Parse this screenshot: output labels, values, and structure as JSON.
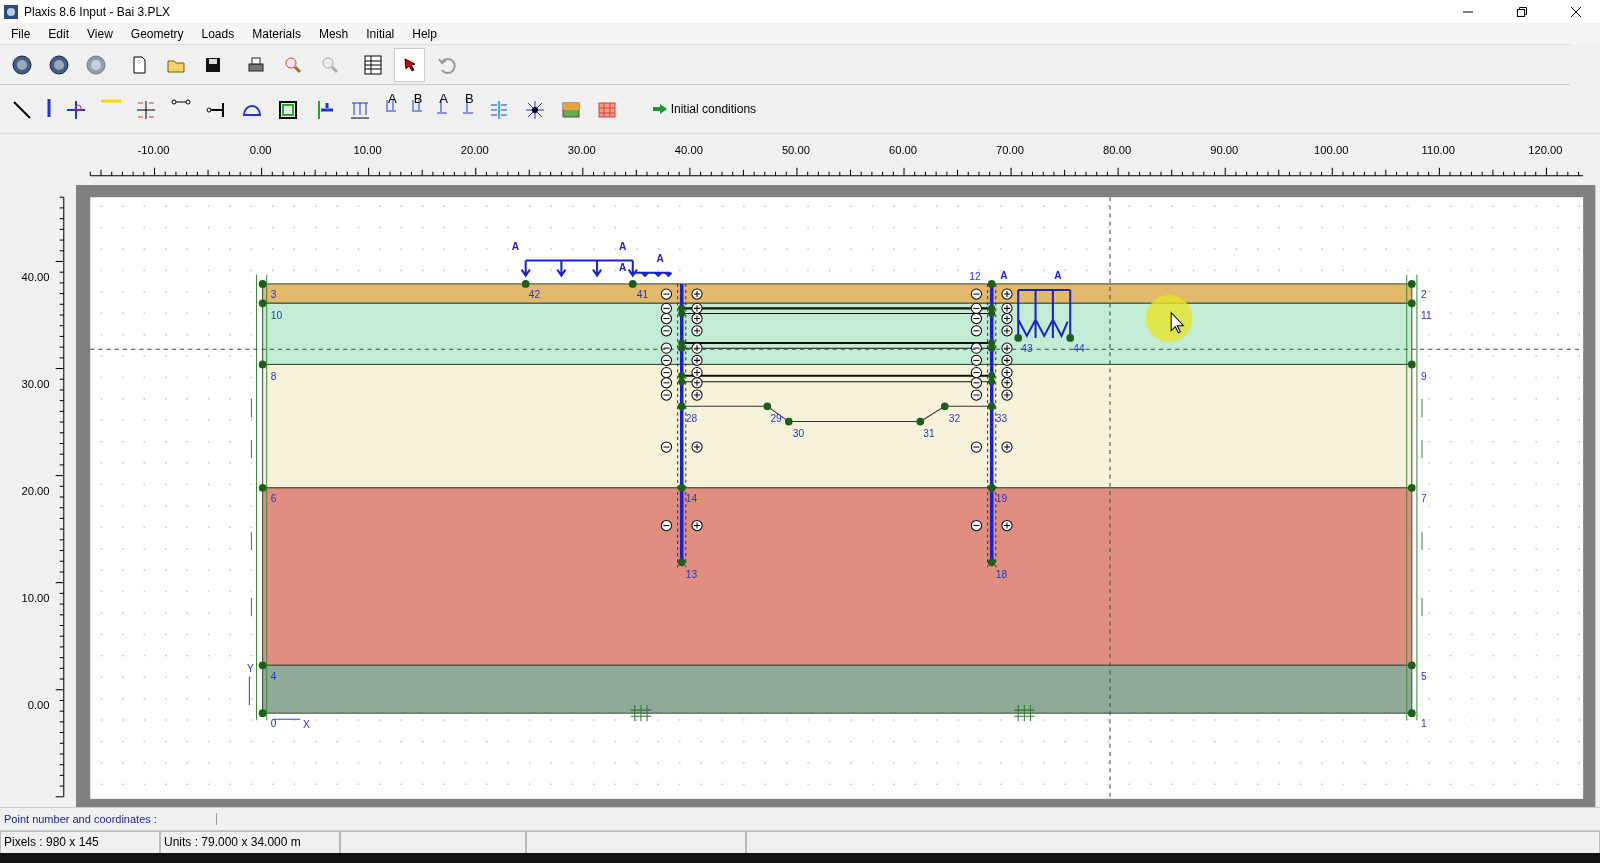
{
  "window": {
    "title": "Plaxis 8.6 Input - Bai 3.PLX"
  },
  "menu": [
    {
      "label": "File"
    },
    {
      "label": "Edit"
    },
    {
      "label": "View"
    },
    {
      "label": "Geometry"
    },
    {
      "label": "Loads"
    },
    {
      "label": "Materials"
    },
    {
      "label": "Mesh"
    },
    {
      "label": "Initial"
    },
    {
      "label": "Help"
    }
  ],
  "toolbar_1": [
    {
      "kind": "logo",
      "selected": false
    },
    {
      "kind": "logo",
      "selected": false
    },
    {
      "kind": "logo-faded",
      "selected": false
    },
    {
      "kind": "new",
      "selected": false
    },
    {
      "kind": "open",
      "selected": false
    },
    {
      "kind": "save",
      "selected": false
    },
    {
      "kind": "print",
      "selected": false
    },
    {
      "kind": "zoom-in",
      "selected": false
    },
    {
      "kind": "zoom-out",
      "selected": false
    },
    {
      "kind": "table",
      "selected": false
    },
    {
      "kind": "pointer",
      "selected": true
    },
    {
      "kind": "undo",
      "selected": false
    }
  ],
  "toolbar_2": [
    {
      "kind": "line"
    },
    {
      "kind": "plate"
    },
    {
      "kind": "node"
    },
    {
      "kind": "geogrid"
    },
    {
      "kind": "interface"
    },
    {
      "kind": "anchor"
    },
    {
      "kind": "fixed-anchor"
    },
    {
      "kind": "tunnel"
    },
    {
      "kind": "boundary"
    },
    {
      "kind": "fixity"
    },
    {
      "kind": "load"
    },
    {
      "kind": "load-a",
      "label": "A"
    },
    {
      "kind": "load-b",
      "label": "B"
    },
    {
      "kind": "point-load-a",
      "label": "A"
    },
    {
      "kind": "point-load-b",
      "label": "B"
    },
    {
      "kind": "drain"
    },
    {
      "kind": "well"
    },
    {
      "kind": "material"
    },
    {
      "kind": "mesh"
    },
    {
      "kind": "button",
      "label": "Initial conditions"
    }
  ],
  "ruler": {
    "x_labels": [
      "-10.00",
      "0.00",
      "10.00",
      "20.00",
      "30.00",
      "40.00",
      "50.00",
      "60.00",
      "70.00",
      "80.00",
      "90.00",
      "100.00",
      "110.00",
      "120.00"
    ],
    "y_labels": [
      "40.00",
      "30.00",
      "20.00",
      "10.00",
      "0.00"
    ]
  },
  "geometry": {
    "layers": [
      {
        "color": "#e3b96c"
      },
      {
        "color": "#c3ecd4"
      },
      {
        "color": "#f7f3da"
      },
      {
        "color": "#e08e80"
      },
      {
        "color": "#8fab98"
      }
    ],
    "points": [
      {
        "label": "3"
      },
      {
        "label": "42"
      },
      {
        "label": "41"
      },
      {
        "label": "12"
      },
      {
        "label": "2"
      },
      {
        "label": "10"
      },
      {
        "label": "11"
      },
      {
        "label": "43"
      },
      {
        "label": "44"
      },
      {
        "label": "8"
      },
      {
        "label": "9"
      },
      {
        "label": "28"
      },
      {
        "label": "29"
      },
      {
        "label": "32"
      },
      {
        "label": "33"
      },
      {
        "label": "30"
      },
      {
        "label": "31"
      },
      {
        "label": "6"
      },
      {
        "label": "14"
      },
      {
        "label": "19"
      },
      {
        "label": "7"
      },
      {
        "label": "13"
      },
      {
        "label": "18"
      },
      {
        "label": "4"
      },
      {
        "label": "5"
      },
      {
        "label": "0"
      },
      {
        "label": "1"
      }
    ],
    "load_labels": [
      "A",
      "A",
      "A",
      "A",
      "A",
      "A"
    ],
    "axis_labels": [
      "Y",
      "X"
    ]
  },
  "status": {
    "prompt": "Point number and coordinates :",
    "pixels": "Pixels : 980 x 145",
    "units": "Units  : 79.000 x 34.000 m"
  }
}
